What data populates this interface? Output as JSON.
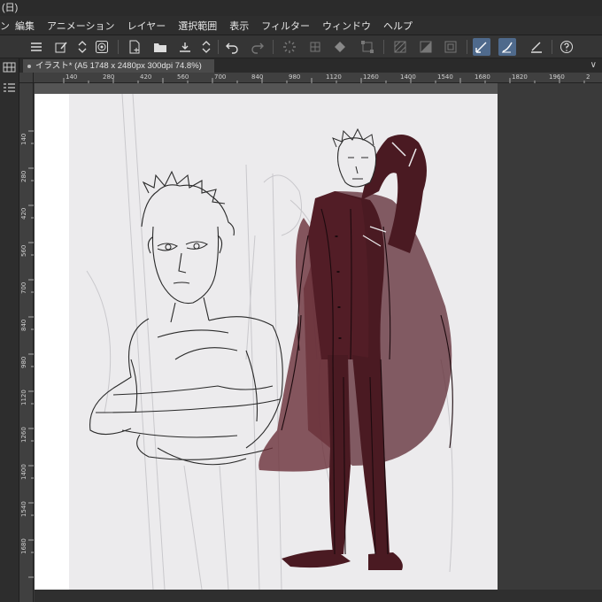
{
  "window": {
    "title_fragment": "(日)"
  },
  "menu": {
    "items": [
      "ン",
      "編集",
      "アニメーション",
      "レイヤー",
      "選択範囲",
      "表示",
      "フィルター",
      "ウィンドウ",
      "ヘルプ"
    ]
  },
  "toolbar": {
    "icons": [
      "menu-icon",
      "new-layer-icon",
      "up-down-icon",
      "target-icon",
      "new-file-icon",
      "open-folder-icon",
      "save-icon",
      "up-down-icon",
      "undo-icon",
      "redo-icon",
      "loading-icon",
      "grid-icon",
      "fill-icon",
      "transform-icon",
      "hatch-icon",
      "tone-icon",
      "frame-icon",
      "pen-active-icon",
      "pen-icon",
      "pen-small-icon",
      "help-icon"
    ]
  },
  "document_tab": {
    "label": "イラスト* (A5 1748 x 2480px 300dpi 74.8%)"
  },
  "ruler": {
    "horizontal": [
      "140",
      "280",
      "420",
      "560",
      "700",
      "840",
      "980",
      "1120",
      "1260",
      "1400",
      "1540",
      "1680",
      "1820",
      "1960",
      "2"
    ],
    "vertical": [
      "140",
      "280",
      "420",
      "560",
      "700",
      "840",
      "980",
      "1120",
      "1260",
      "1400",
      "1540",
      "1680"
    ]
  },
  "colors": {
    "cape": "#5e2a33",
    "uniform": "#4a1a22",
    "sketch": "#2a2a2a",
    "paper": "#ecebed",
    "accent": "#4f6a8c"
  }
}
